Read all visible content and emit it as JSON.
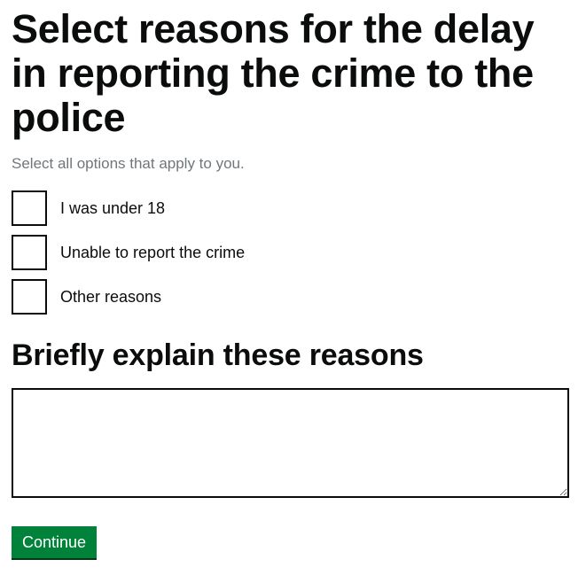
{
  "page": {
    "title": "Select reasons for the delay in reporting the crime to the police",
    "hint": "Select all options that apply to you."
  },
  "checkboxes": [
    {
      "label": "I was under 18",
      "checked": false
    },
    {
      "label": "Unable to report the crime",
      "checked": false
    },
    {
      "label": "Other reasons",
      "checked": false
    }
  ],
  "explain": {
    "heading": "Briefly explain these reasons",
    "value": ""
  },
  "actions": {
    "continue_label": "Continue"
  },
  "colors": {
    "text": "#0b0c0c",
    "hint": "#6f777b",
    "button": "#00823b",
    "button_shadow": "#003618"
  }
}
